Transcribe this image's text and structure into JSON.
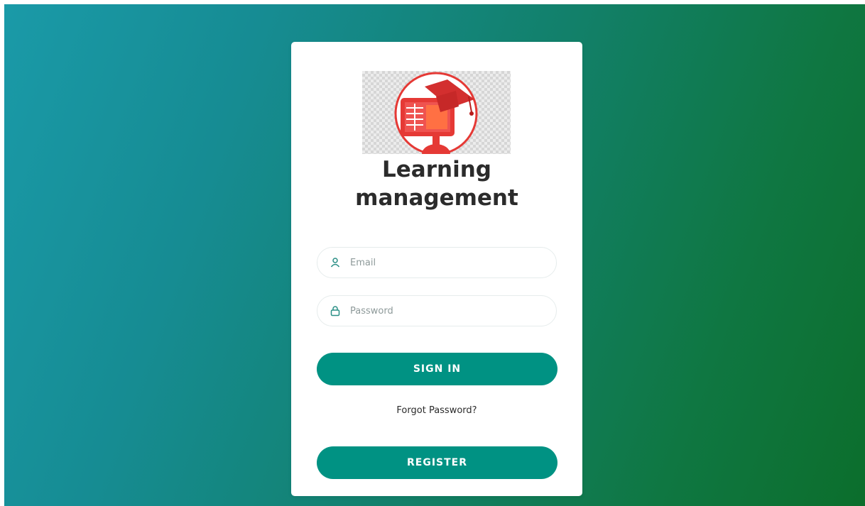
{
  "app": {
    "title_line1": "Learning",
    "title_line2": "management"
  },
  "form": {
    "email_placeholder": "Email",
    "email_value": "",
    "password_placeholder": "Password",
    "password_value": ""
  },
  "buttons": {
    "signin_label": "SIGN IN",
    "register_label": "REGISTER"
  },
  "links": {
    "forgot_password": "Forgot Password?"
  },
  "icons": {
    "email": "user-icon",
    "password": "lock-icon",
    "logo": "graduation-cap-monitor-logo"
  },
  "colors": {
    "accent": "#009283",
    "logo_red": "#e53935",
    "background_start": "#1a9aa8",
    "background_end": "#0c6e2c"
  }
}
